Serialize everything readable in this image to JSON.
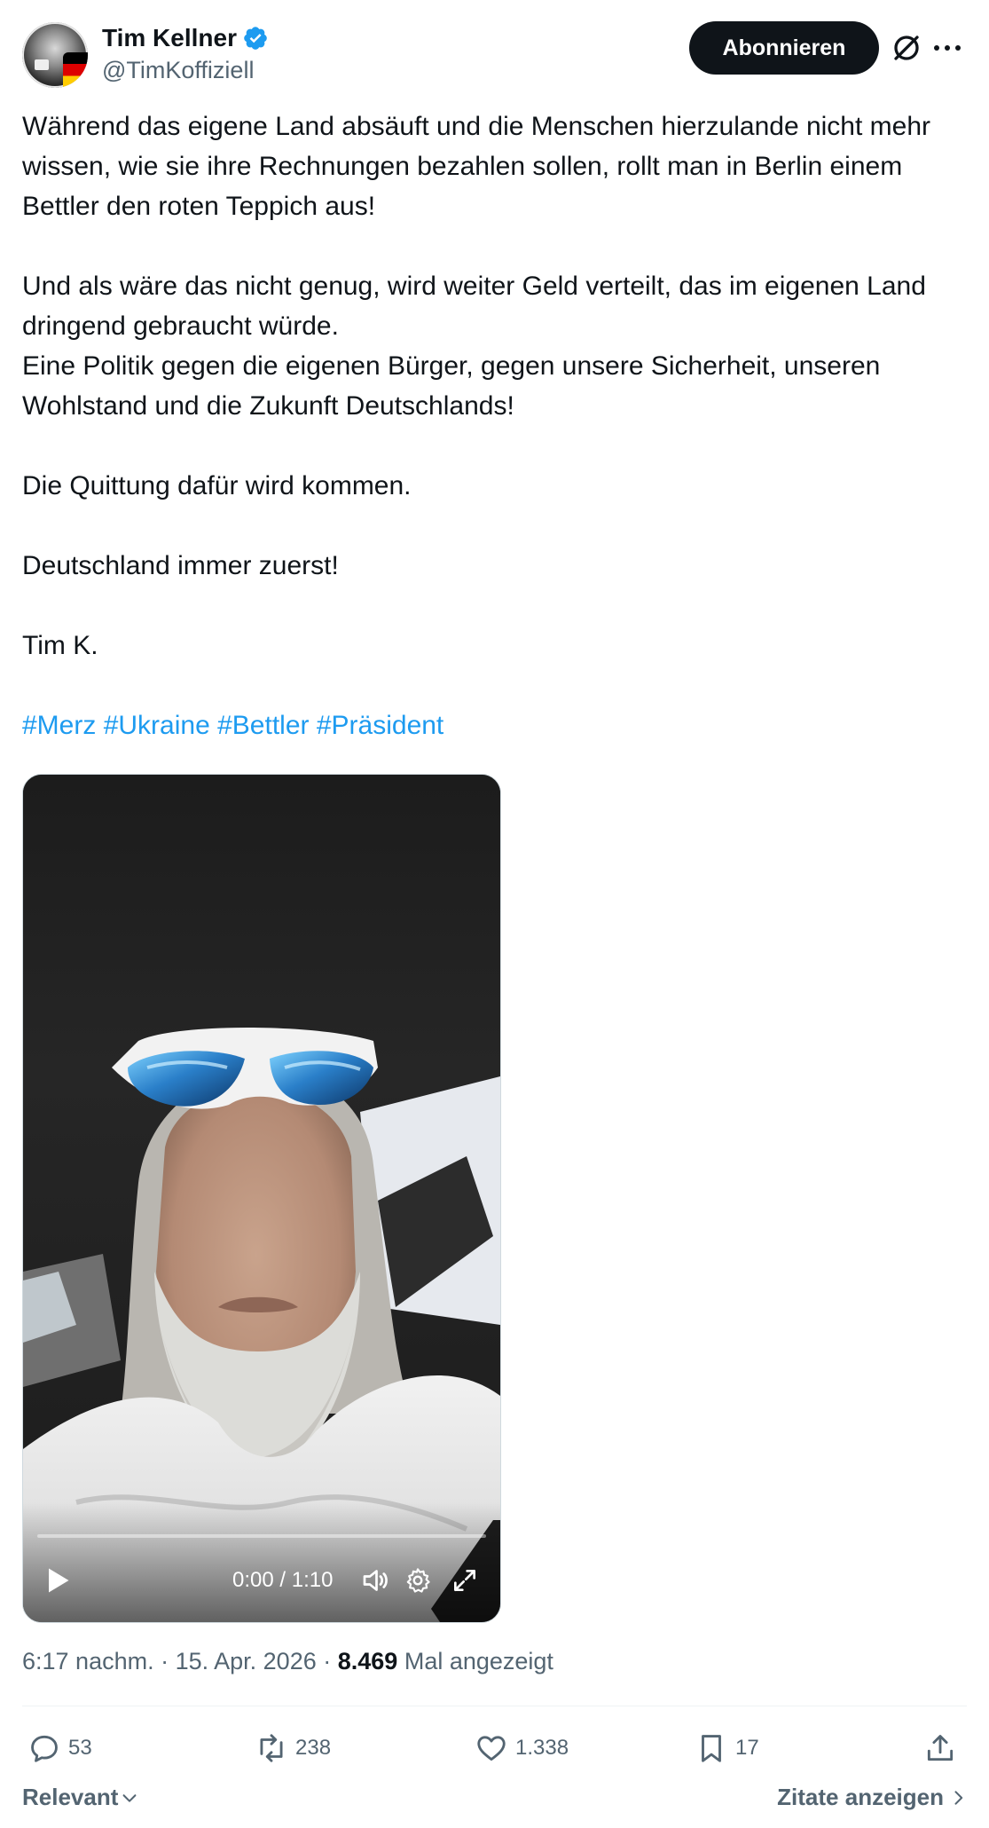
{
  "author": {
    "display_name": "Tim Kellner",
    "handle": "@TimKoffiziell",
    "verified_icon": "verified-badge-icon",
    "accent_color": "#1d9bf0"
  },
  "header": {
    "subscribe_label": "Abonnieren"
  },
  "tweet": {
    "paragraphs": [
      "Während das eigene Land absäuft und die Menschen hierzulande nicht mehr wissen, wie sie ihre Rechnungen bezahlen sollen, rollt man in Berlin einem Bettler den roten Teppich aus!",
      "",
      "Und als wäre das nicht genug, wird weiter Geld verteilt, das im eigenen Land dringend gebraucht würde.",
      "Eine Politik gegen die eigenen Bürger, gegen unsere Sicherheit, unseren Wohlstand und die Zukunft Deutschlands!",
      "",
      "Die Quittung dafür wird kommen.",
      "",
      "Deutschland immer zuerst!",
      "",
      "Tim K.",
      ""
    ],
    "hashtags": [
      "#Merz",
      "#Ukraine",
      "#Bettler",
      "#Präsident"
    ]
  },
  "video": {
    "time_readout": "0:00 / 1:10",
    "progress": 0
  },
  "meta": {
    "time": "6:17 nachm.",
    "separator": " · ",
    "date": "15. Apr. 2026",
    "views_count": "8.469",
    "views_label": "Mal angezeigt"
  },
  "actions": {
    "replies": "53",
    "reposts": "238",
    "likes": "1.338",
    "bookmarks": "17"
  },
  "footer": {
    "sort_label": "Relevant",
    "quotes_label": "Zitate anzeigen"
  }
}
